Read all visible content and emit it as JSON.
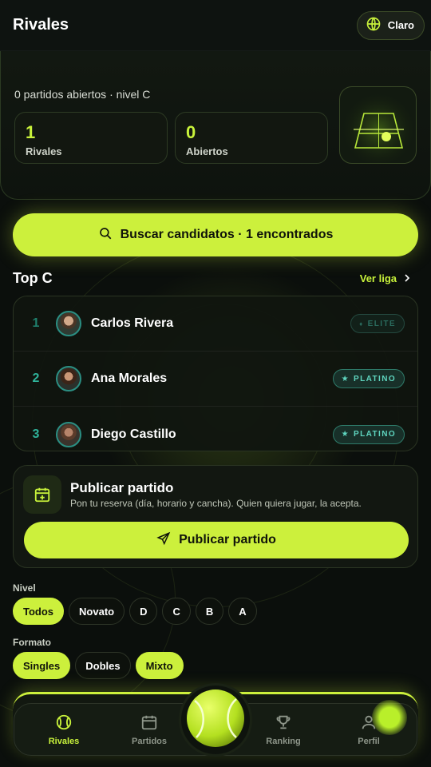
{
  "header": {
    "title": "Rivales",
    "theme_label": "Claro"
  },
  "summary": {
    "subtitle": "0 partidos abiertos · nivel C",
    "stats": [
      {
        "value": "1",
        "label": "Rivales"
      },
      {
        "value": "0",
        "label": "Abiertos"
      }
    ]
  },
  "search": {
    "label": "Buscar candidatos · 1 encontrados"
  },
  "top": {
    "title": "Top C",
    "link": "Ver liga",
    "players": [
      {
        "rank": "1",
        "name": "Carlos Rivera",
        "tier": "ELITE"
      },
      {
        "rank": "2",
        "name": "Ana Morales",
        "tier": "PLATINO"
      },
      {
        "rank": "3",
        "name": "Diego Castillo",
        "tier": "PLATINO"
      }
    ]
  },
  "publish": {
    "title": "Publicar partido",
    "description": "Pon tu reserva (día, horario y cancha). Quien quiera jugar, la acepta.",
    "button": "Publicar partido"
  },
  "filters": {
    "level_label": "Nivel",
    "levels": [
      "Todos",
      "Novato",
      "D",
      "C",
      "B",
      "A"
    ],
    "levels_selected": [
      "Todos"
    ],
    "format_label": "Formato",
    "formats": [
      "Singles",
      "Dobles",
      "Mixto"
    ],
    "formats_selected": [
      "Singles",
      "Mixto"
    ]
  },
  "nav": {
    "items": [
      {
        "label": "Rivales",
        "icon": "tennis-ball-icon",
        "active": true
      },
      {
        "label": "Partidos",
        "icon": "calendar-icon",
        "active": false
      },
      {
        "label": "Ranking",
        "icon": "trophy-icon",
        "active": false
      },
      {
        "label": "Perfil",
        "icon": "user-icon",
        "active": false
      }
    ]
  },
  "colors": {
    "accent": "#ccf03c",
    "background": "#0b0f0c",
    "teal": "#2fb39a"
  }
}
